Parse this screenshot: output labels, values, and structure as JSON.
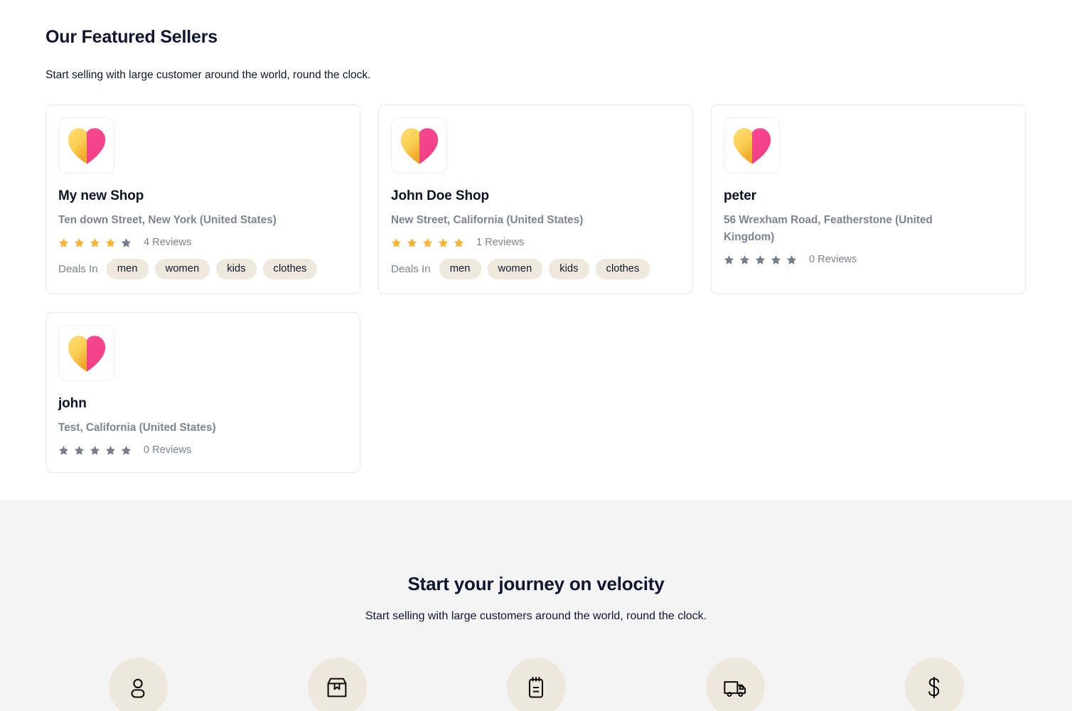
{
  "featured": {
    "title": "Our Featured Sellers",
    "subtitle": "Start selling with large customer around the world, round the clock.",
    "deals_label": "Deals In",
    "sellers": [
      {
        "name": "My new Shop",
        "address": "Ten down Street, New York (United States)",
        "rating": 4,
        "reviews": "4 Reviews",
        "tags": [
          "men",
          "women",
          "kids",
          "clothes"
        ],
        "logo": "heart-logo"
      },
      {
        "name": "John Doe Shop",
        "address": "New Street, California (United States)",
        "rating": 5,
        "reviews": "1 Reviews",
        "tags": [
          "men",
          "women",
          "kids",
          "clothes"
        ],
        "logo": "heart-logo"
      },
      {
        "name": "peter",
        "address": "56 Wrexham Road, Featherstone (United Kingdom)",
        "rating": 0,
        "reviews": "0 Reviews",
        "tags": [],
        "logo": "heart-logo"
      },
      {
        "name": "john",
        "address": "Test, California (United States)",
        "rating": 0,
        "reviews": "0 Reviews",
        "tags": [],
        "logo": "heart-logo"
      }
    ]
  },
  "journey": {
    "title": "Start your journey on velocity",
    "subtitle": "Start selling with large customers around the world, round the clock.",
    "steps": [
      {
        "icon": "user-icon"
      },
      {
        "icon": "package-box-icon"
      },
      {
        "icon": "clipboard-icon"
      },
      {
        "icon": "delivery-truck-icon"
      },
      {
        "icon": "dollar-sign-icon"
      }
    ]
  },
  "colors": {
    "star_filled": "#f9b233",
    "star_empty": "#787f88",
    "tag_background": "#eee8dd",
    "step_circle_background": "#ede7dc",
    "journey_background": "#f4f4f4",
    "logo_yellow": "#fbd45e",
    "logo_yellow_dark": "#f2b233",
    "logo_pink": "#f5418a",
    "card_border": "#e8e9ec",
    "muted_text": "#7b8490",
    "heading_text": "#10162f"
  }
}
